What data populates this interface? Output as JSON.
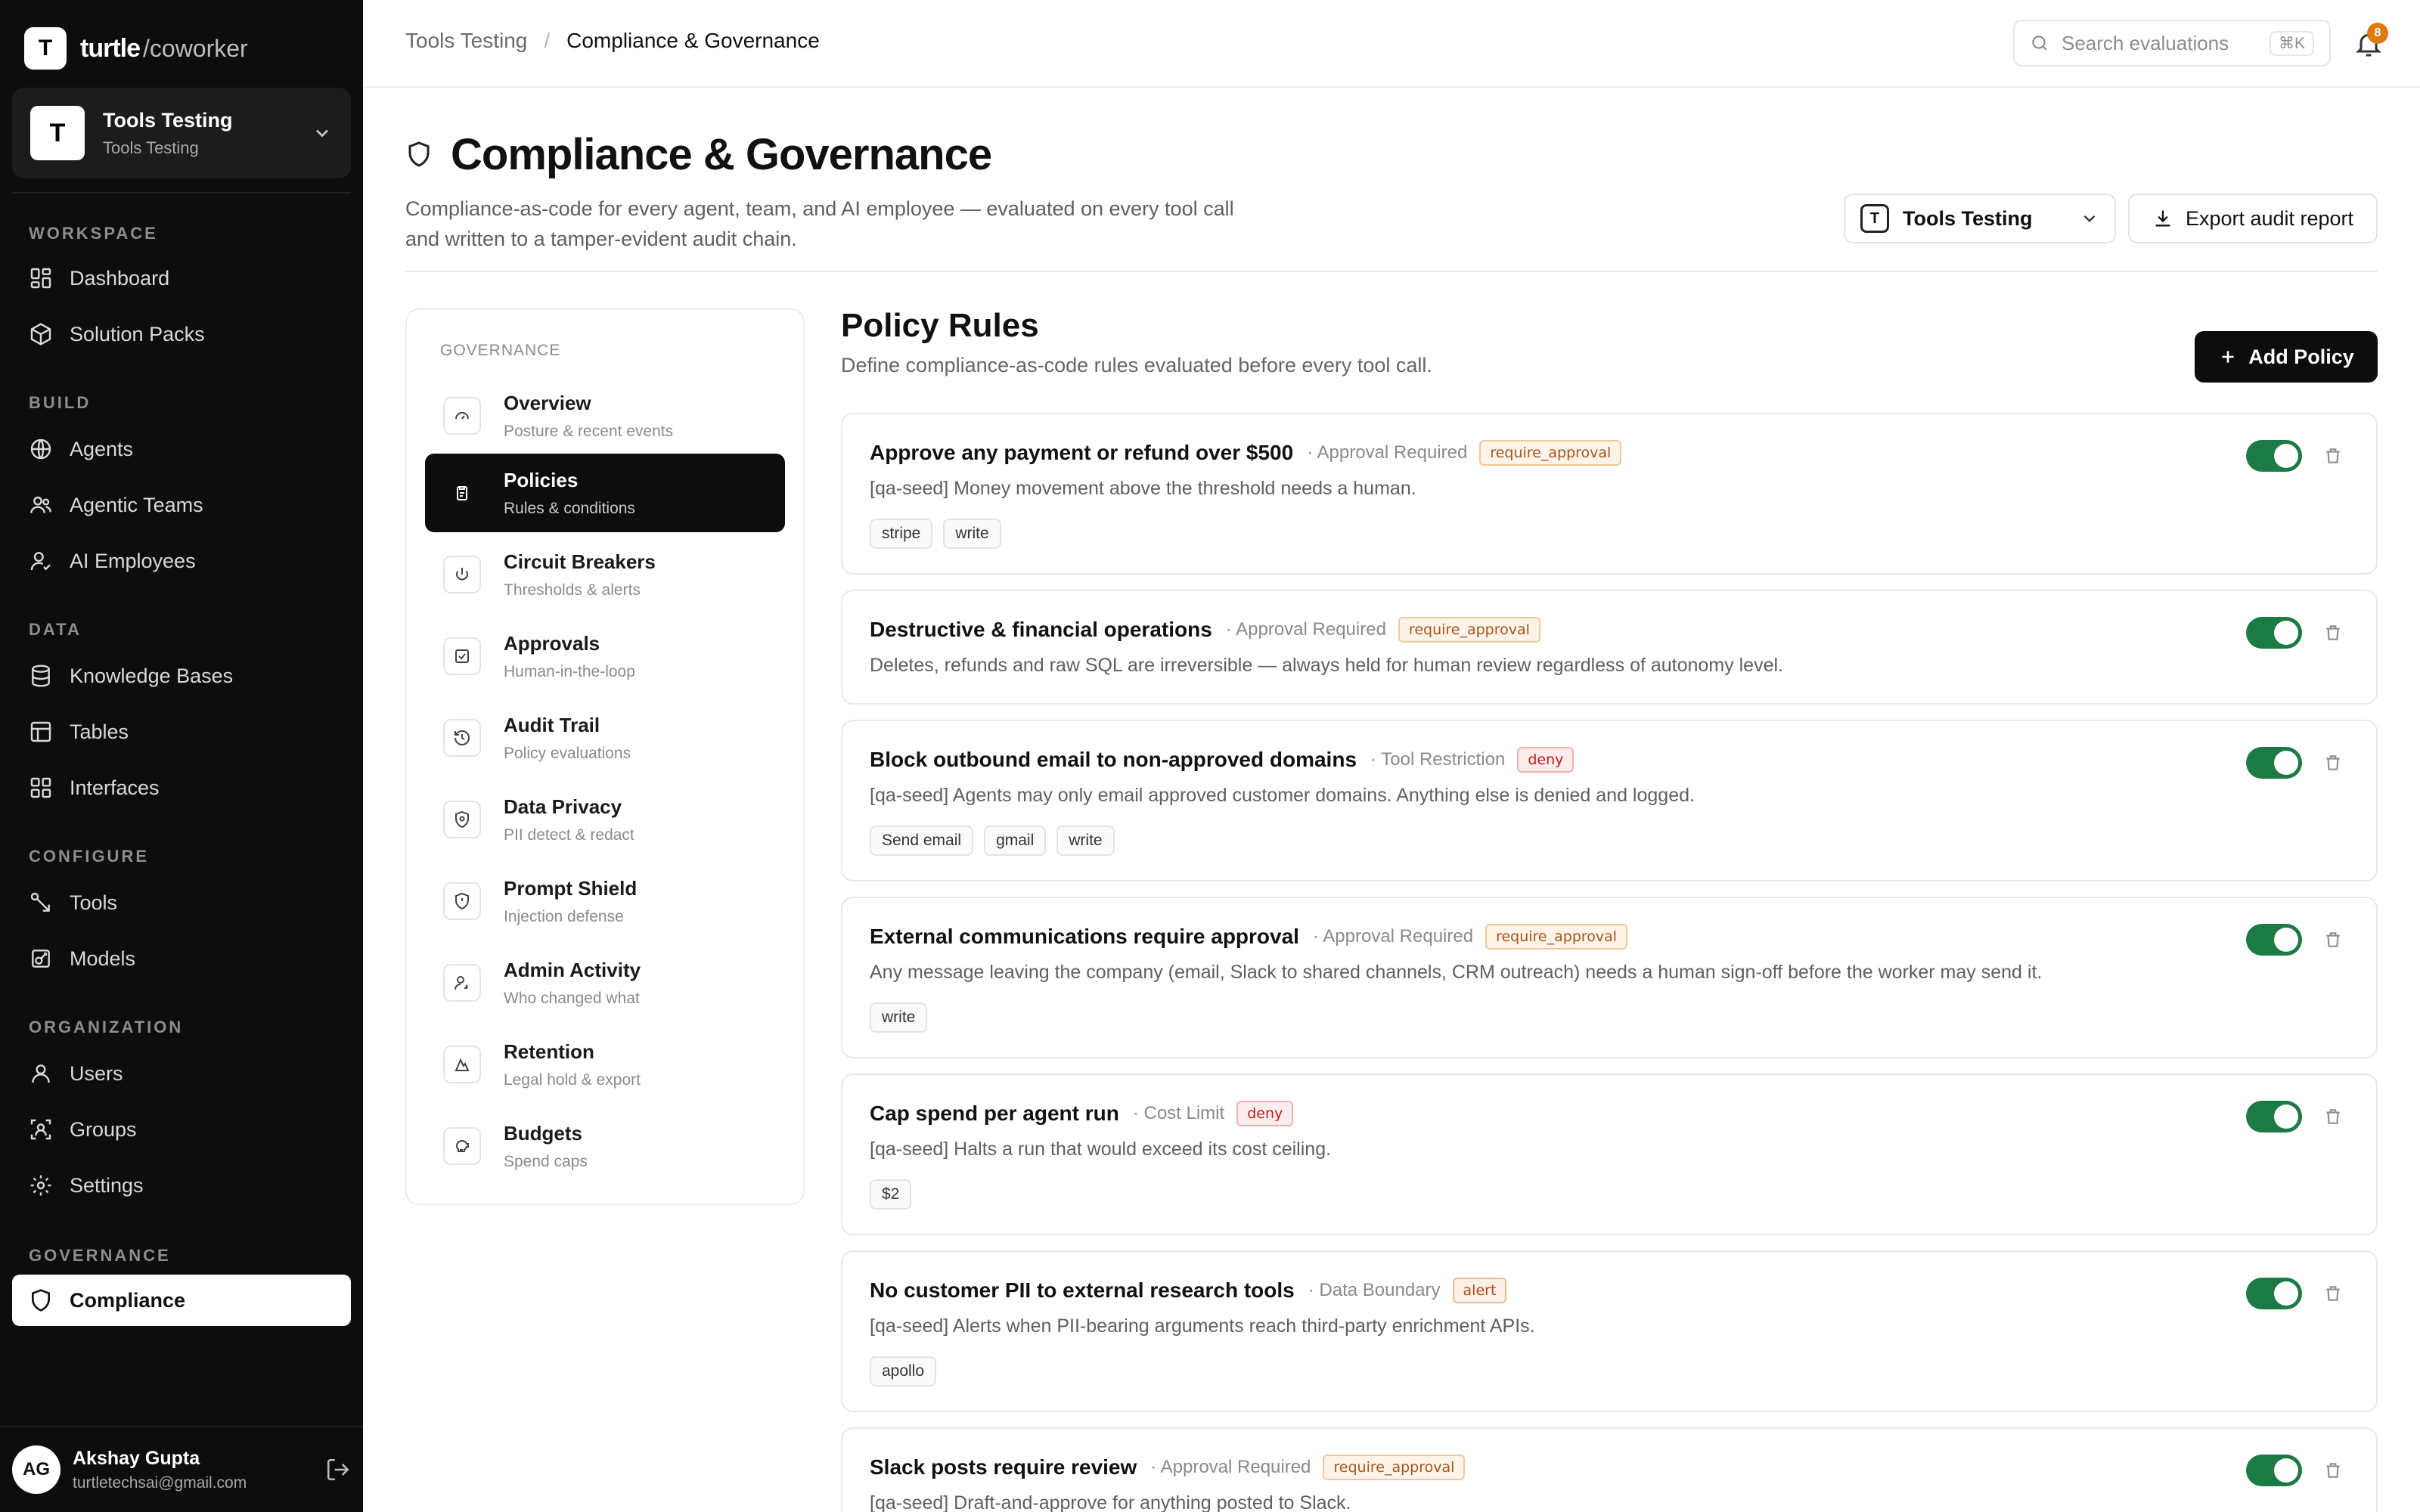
{
  "brand": {
    "logo_letter": "T",
    "name": "turtle",
    "suffix": "/coworker"
  },
  "workspace": {
    "avatar": "T",
    "title": "Tools Testing",
    "subtitle": "Tools Testing"
  },
  "nav": {
    "workspace_label": "WORKSPACE",
    "dashboard": "Dashboard",
    "solution_packs": "Solution Packs",
    "build_label": "BUILD",
    "agents": "Agents",
    "agentic_teams": "Agentic Teams",
    "ai_employees": "AI Employees",
    "data_label": "DATA",
    "knowledge_bases": "Knowledge Bases",
    "tables": "Tables",
    "interfaces": "Interfaces",
    "configure_label": "CONFIGURE",
    "tools": "Tools",
    "models": "Models",
    "organization_label": "ORGANIZATION",
    "users": "Users",
    "groups": "Groups",
    "settings": "Settings",
    "governance_label": "GOVERNANCE",
    "compliance": "Compliance"
  },
  "user": {
    "initials": "AG",
    "name": "Akshay Gupta",
    "email": "turtletechsai@gmail.com"
  },
  "topbar": {
    "breadcrumb_parent": "Tools Testing",
    "breadcrumb_separator": "/",
    "breadcrumb_current": "Compliance & Governance",
    "search_placeholder": "Search evaluations",
    "search_shortcut": "⌘K",
    "notification_count": "8"
  },
  "header": {
    "title": "Compliance & Governance",
    "description": "Compliance-as-code for every agent, team, and AI employee — evaluated on every tool call and written to a tamper-evident audit chain.",
    "org_badge": "T",
    "org_select_value": "Tools Testing",
    "export_label": "Export audit report"
  },
  "subnav": {
    "section_label": "GOVERNANCE",
    "items": [
      {
        "title": "Overview",
        "desc": "Posture & recent events"
      },
      {
        "title": "Policies",
        "desc": "Rules & conditions"
      },
      {
        "title": "Circuit Breakers",
        "desc": "Thresholds & alerts"
      },
      {
        "title": "Approvals",
        "desc": "Human-in-the-loop"
      },
      {
        "title": "Audit Trail",
        "desc": "Policy evaluations"
      },
      {
        "title": "Data Privacy",
        "desc": "PII detect & redact"
      },
      {
        "title": "Prompt Shield",
        "desc": "Injection defense"
      },
      {
        "title": "Admin Activity",
        "desc": "Who changed what"
      },
      {
        "title": "Retention",
        "desc": "Legal hold & export"
      },
      {
        "title": "Budgets",
        "desc": "Spend caps"
      }
    ]
  },
  "policies": {
    "title": "Policy Rules",
    "description": "Define compliance-as-code rules evaluated before every tool call.",
    "add_label": "Add Policy",
    "items": [
      {
        "name": "Approve any payment or refund over $500",
        "kind": "· Approval Required",
        "action": "require_approval",
        "desc": "[qa-seed] Money movement above the threshold needs a human.",
        "tags": [
          "stripe",
          "write"
        ],
        "enabled": true
      },
      {
        "name": "Destructive & financial operations",
        "kind": "· Approval Required",
        "action": "require_approval",
        "desc": "Deletes, refunds and raw SQL are irreversible — always held for human review regardless of autonomy level.",
        "tags": [],
        "enabled": true
      },
      {
        "name": "Block outbound email to non-approved domains",
        "kind": "· Tool Restriction",
        "action": "deny",
        "desc": "[qa-seed] Agents may only email approved customer domains. Anything else is denied and logged.",
        "tags": [
          "Send email",
          "gmail",
          "write"
        ],
        "enabled": true
      },
      {
        "name": "External communications require approval",
        "kind": "· Approval Required",
        "action": "require_approval",
        "desc": "Any message leaving the company (email, Slack to shared channels, CRM outreach) needs a human sign-off before the worker may send it.",
        "tags": [
          "write"
        ],
        "enabled": true
      },
      {
        "name": "Cap spend per agent run",
        "kind": "· Cost Limit",
        "action": "deny",
        "desc": "[qa-seed] Halts a run that would exceed its cost ceiling.",
        "tags": [
          "$2"
        ],
        "enabled": true
      },
      {
        "name": "No customer PII to external research tools",
        "kind": "· Data Boundary",
        "action": "alert",
        "desc": "[qa-seed] Alerts when PII-bearing arguments reach third-party enrichment APIs.",
        "tags": [
          "apollo"
        ],
        "enabled": true
      },
      {
        "name": "Slack posts require review",
        "kind": "· Approval Required",
        "action": "require_approval",
        "desc": "[qa-seed] Draft-and-approve for anything posted to Slack.",
        "tags": [],
        "enabled": true
      }
    ]
  },
  "colors": {
    "sidebar_bg": "#0d0d0d",
    "toggle_on": "#1c7a44",
    "badge_approval": "#a8551a",
    "badge_deny": "#c01d1d",
    "badge_alert": "#b4491a",
    "notification": "#e07a10"
  },
  "icons": {
    "nav": [
      "dashboard-icon",
      "package-icon",
      "agent-icon",
      "team-icon",
      "ai-employee-icon",
      "database-icon",
      "table-icon",
      "interface-icon",
      "wrench-icon",
      "model-icon",
      "user-icon",
      "group-icon",
      "settings-icon",
      "shield-icon"
    ],
    "subnav": [
      "gauge-icon",
      "clipboard-icon",
      "power-icon",
      "checkbox-icon",
      "history-icon",
      "privacy-shield-icon",
      "prompt-shield-icon",
      "admin-user-icon",
      "archive-icon",
      "budget-icon"
    ]
  }
}
